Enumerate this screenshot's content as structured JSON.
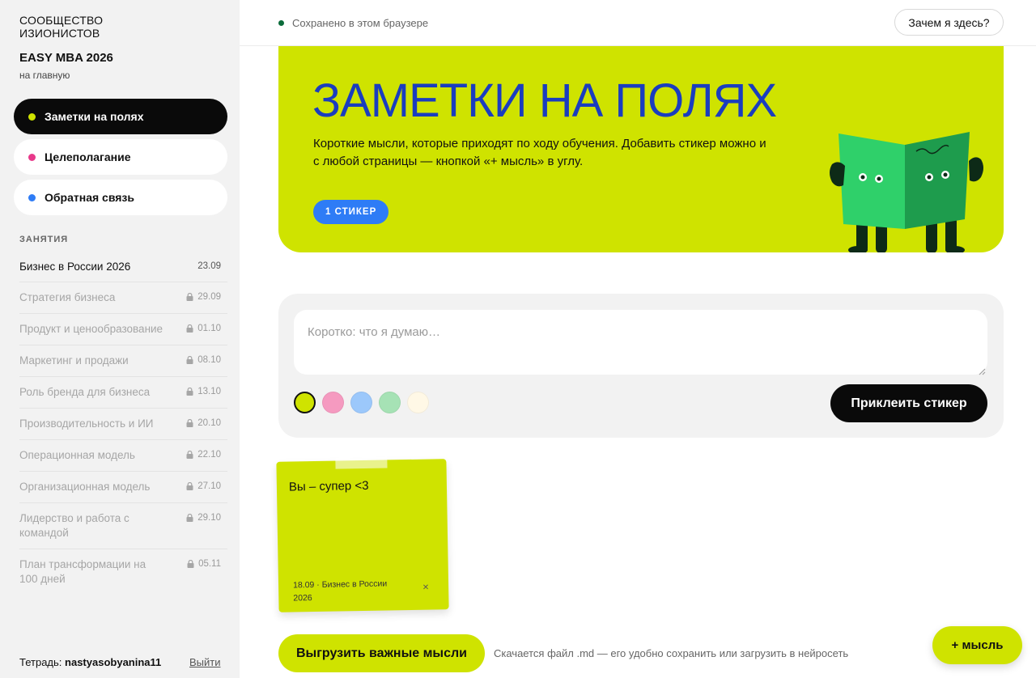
{
  "sidebar": {
    "brand_line1": "СООБЩЕСТВО",
    "brand_line2": "ИЗИОНИСТОВ",
    "course_title": "EASY MBA 2026",
    "home_link": "на главную",
    "nav": [
      {
        "label": "Заметки на полях",
        "dot_color": "#cfe300",
        "active": true
      },
      {
        "label": "Целеполагание",
        "dot_color": "#e8398a",
        "active": false
      },
      {
        "label": "Обратная связь",
        "dot_color": "#2e7cf6",
        "active": false
      }
    ],
    "section_label": "ЗАНЯТИЯ",
    "lessons": [
      {
        "title": "Бизнес в России 2026",
        "date": "23.09",
        "locked": false
      },
      {
        "title": "Стратегия бизнеса",
        "date": "29.09",
        "locked": true
      },
      {
        "title": "Продукт и ценообразование",
        "date": "01.10",
        "locked": true
      },
      {
        "title": "Маркетинг и продажи",
        "date": "08.10",
        "locked": true
      },
      {
        "title": "Роль бренда для бизнеса",
        "date": "13.10",
        "locked": true
      },
      {
        "title": "Производительность и ИИ",
        "date": "20.10",
        "locked": true
      },
      {
        "title": "Операционная модель",
        "date": "22.10",
        "locked": true
      },
      {
        "title": "Организационная модель",
        "date": "27.10",
        "locked": true
      },
      {
        "title": "Лидерство и работа с командой",
        "date": "29.10",
        "locked": true
      },
      {
        "title": "План трансформации на 100 дней",
        "date": "05.11",
        "locked": true
      }
    ],
    "notebook_label": "Тетрадь:",
    "notebook_user": "nastyasobyanina11",
    "logout": "Выйти"
  },
  "topbar": {
    "saved_status": "Сохранено в этом браузере",
    "why_button": "Зачем я здесь?"
  },
  "hero": {
    "title": "ЗАМЕТКИ НА ПОЛЯХ",
    "description": "Короткие мысли, которые приходят по ходу обучения. Добавить стикер можно и с любой страницы — кнопкой «+ мысль» в углу.",
    "sticker_count": "1 СТИКЕР"
  },
  "composer": {
    "placeholder": "Коротко: что я думаю…",
    "value": "",
    "colors": [
      "#cfe300",
      "#f59ac0",
      "#9cc8fb",
      "#a6e2b5",
      "#fff8e6"
    ],
    "selected_color": "#cfe300",
    "submit_label": "Приклеить стикер"
  },
  "notes": [
    {
      "text": "Вы – супер <3",
      "meta": "18.09 · Бизнес в России 2026",
      "close": "×",
      "color": "#cfe300"
    }
  ],
  "footer": {
    "export_label": "Выгрузить важные мысли",
    "export_hint": "Скачается файл .md — его удобно сохранить или загрузить в нейросеть",
    "fab_label": "+ мысль"
  },
  "colors": {
    "accent": "#cfe300",
    "hero_title": "#1a3dbf",
    "badge_blue": "#2e7cf6",
    "saved_dot": "#0b6b3a"
  },
  "icons": {
    "lock": "lock-icon",
    "close": "close-icon",
    "illustration": "book-reader-illustration"
  }
}
